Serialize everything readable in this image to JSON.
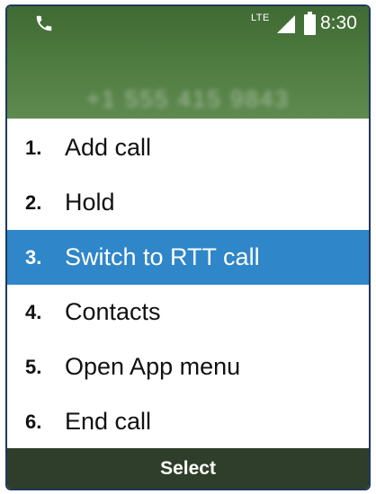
{
  "status_bar": {
    "network_label": "LTE",
    "time": "8:30",
    "icons": [
      "phone-icon",
      "signal-icon",
      "battery-icon"
    ]
  },
  "call": {
    "number": "+1 555 415 9843"
  },
  "menu": {
    "items": [
      {
        "num": "1.",
        "label": "Add call"
      },
      {
        "num": "2.",
        "label": "Hold"
      },
      {
        "num": "3.",
        "label": "Switch to RTT call"
      },
      {
        "num": "4.",
        "label": "Contacts"
      },
      {
        "num": "5.",
        "label": "Open App menu"
      },
      {
        "num": "6.",
        "label": "End call"
      }
    ],
    "selected_index": 2
  },
  "softkey": {
    "center_label": "Select"
  },
  "colors": {
    "header": "#4d7a3f",
    "selection": "#2f86c8",
    "softkey_bar": "#2e3e2a",
    "frame_border": "#1f3760"
  }
}
